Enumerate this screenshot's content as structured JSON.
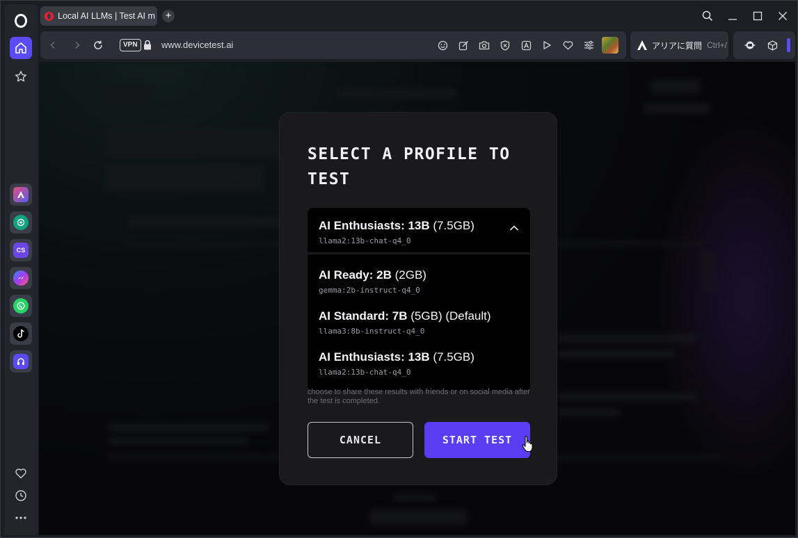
{
  "browser": {
    "tab": {
      "title": "Local AI LLMs | Test AI mo"
    },
    "address": {
      "vpn_label": "VPN",
      "url": "www.devicetest.ai"
    },
    "aria": {
      "label": "アリアに質問",
      "shortcut": "Ctrl+/"
    }
  },
  "modal": {
    "title_line1": "SELECT A PROFILE TO",
    "title_line2": "TEST",
    "selected": {
      "name": "AI Enthusiasts: 13B",
      "size": "(7.5GB)",
      "model": "llama2:13b-chat-q4_0"
    },
    "options": [
      {
        "name": "AI Ready: 2B",
        "size": "(2GB)",
        "model": "gemma:2b-instruct-q4_0"
      },
      {
        "name": "AI Standard: 7B",
        "size": "(5GB) (Default)",
        "model": "llama3:8b-instruct-q4_0"
      },
      {
        "name": "AI Enthusiasts: 13B",
        "size": "(7.5GB)",
        "model": "llama2:13b-chat-q4_0"
      }
    ],
    "share_text_line1": "choose to share these results with friends or on social media after",
    "share_text_line2": "the test is completed.",
    "cancel_label": "CANCEL",
    "start_label": "START TEST"
  },
  "colors": {
    "accent": "#5a3cf2",
    "home_active": "#5a4bf5",
    "opera_red": "#e8222d"
  },
  "icons": [
    "opera-logo-icon",
    "home-icon",
    "star-icon",
    "aria-icon",
    "chatgpt-icon",
    "chatsonic-icon",
    "messenger-icon",
    "whatsapp-icon",
    "tiktok-icon",
    "music-icon",
    "heart-icon",
    "history-icon",
    "more-icon",
    "search-icon",
    "minimize-icon",
    "maximize-icon",
    "close-icon",
    "back-icon",
    "forward-icon",
    "reload-icon",
    "lock-icon",
    "emoji-icon",
    "edit-icon",
    "camera-icon",
    "shield-icon",
    "translate-icon",
    "play-icon",
    "heart-icon",
    "easy-setup-icon",
    "chevron-up-icon",
    "cursor-hand-icon"
  ]
}
